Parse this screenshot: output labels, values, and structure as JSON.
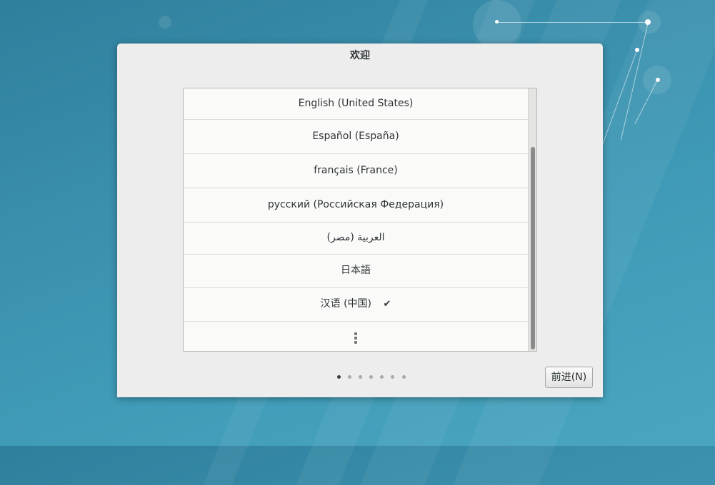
{
  "dialog": {
    "title": "欢迎"
  },
  "languages": [
    {
      "label": "English (United States)",
      "selected": false
    },
    {
      "label": "Español (España)",
      "selected": false
    },
    {
      "label": "français (France)",
      "selected": false
    },
    {
      "label": "русский (Российская Федерация)",
      "selected": false
    },
    {
      "label": "العربية (مصر)",
      "selected": false
    },
    {
      "label": "日本語",
      "selected": false
    },
    {
      "label": "汉语 (中国)",
      "selected": true
    }
  ],
  "icons": {
    "selected": "check-icon",
    "more": "more-vertical-icon"
  },
  "pager": {
    "total_pages": 7,
    "current_page": 1
  },
  "buttons": {
    "next_label": "前进(N)"
  }
}
